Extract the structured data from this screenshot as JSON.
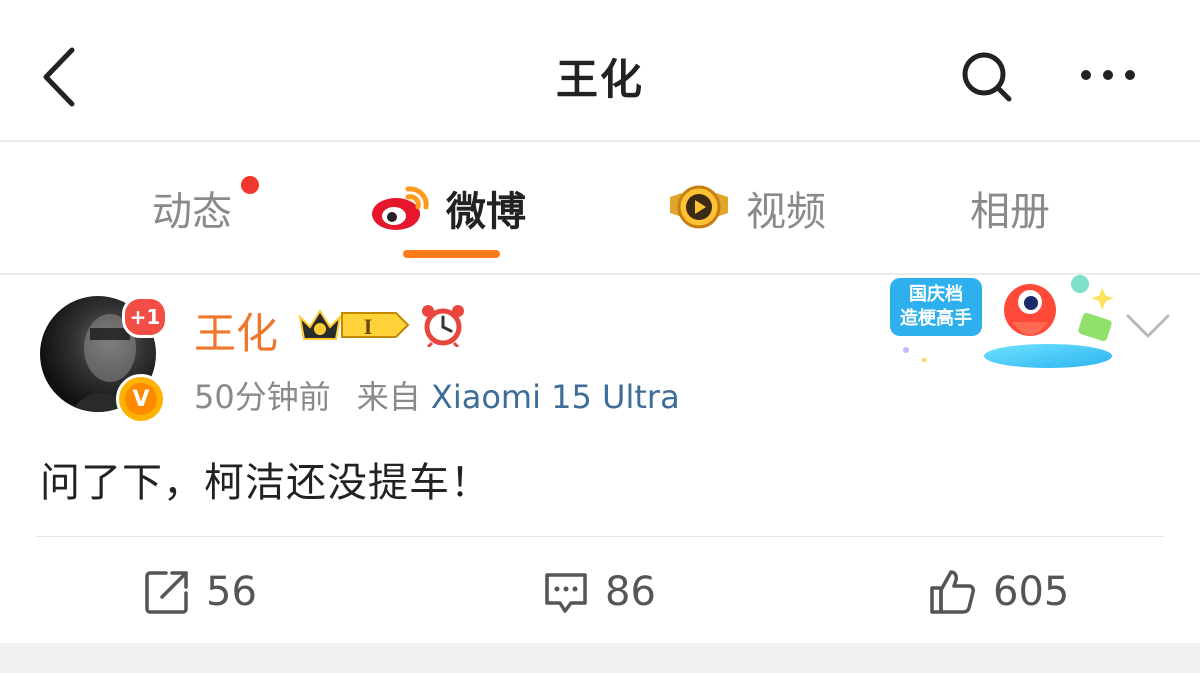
{
  "header": {
    "title": "王化",
    "back_icon": "chevron-left-icon",
    "search_icon": "search-icon",
    "more_icon": "more-horizontal-icon"
  },
  "tabs": [
    {
      "label": "动态",
      "has_dot": true
    },
    {
      "label": "微博",
      "active": true,
      "icon": "weibo-logo-icon"
    },
    {
      "label": "视频",
      "icon": "video-play-icon"
    },
    {
      "label": "相册"
    }
  ],
  "post": {
    "author": "王化",
    "avatar_badge": "+1",
    "verified_mark": "V",
    "member_level": "I",
    "time": "50分钟前",
    "source_prefix": "来自",
    "device": "Xiaomi 15 Ultra",
    "promo_lines": [
      "国庆档",
      "造梗高手"
    ],
    "text": "问了下，柯洁还没提车！",
    "reposts": "56",
    "comments": "86",
    "likes": "605"
  },
  "colors": {
    "accent_orange": "#ff7a19",
    "author_orange": "#f0762b",
    "link_blue": "#3f6d99",
    "dot_red": "#f0372e"
  }
}
